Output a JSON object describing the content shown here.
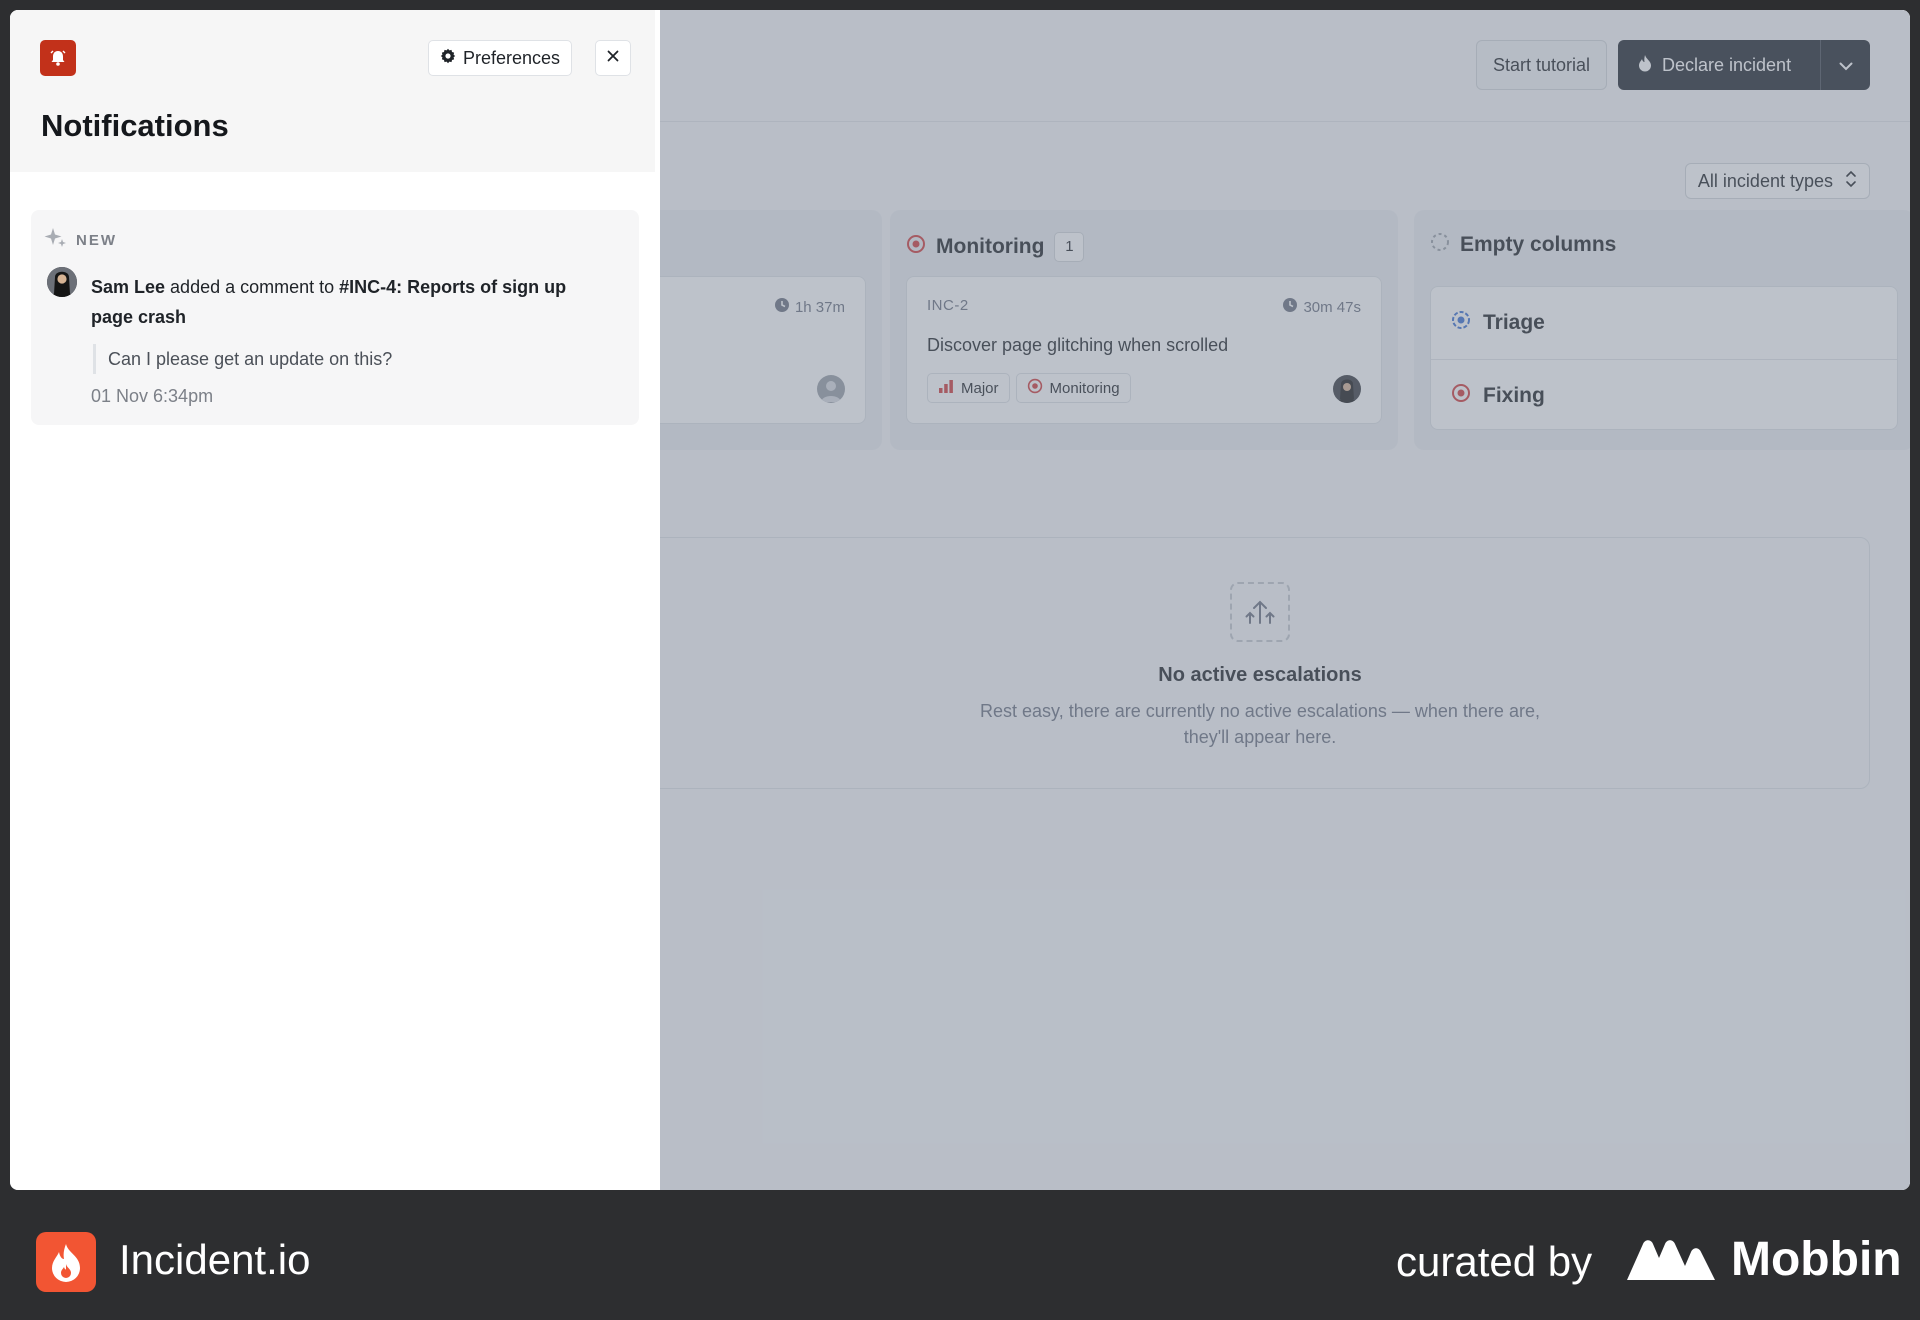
{
  "header": {
    "start_tutorial": "Start tutorial",
    "declare_incident": "Declare incident"
  },
  "filters": {
    "incident_types": "All incident types"
  },
  "board": {
    "col_a": {
      "duration": "1h 37m"
    },
    "monitoring": {
      "title": "Monitoring",
      "count": "1",
      "card": {
        "ref": "INC-2",
        "duration": "30m 47s",
        "title": "Discover page glitching when scrolled",
        "severity": "Major",
        "status": "Monitoring"
      }
    },
    "empty_columns": {
      "title": "Empty columns",
      "items": [
        "Triage",
        "Fixing"
      ]
    }
  },
  "escalations": {
    "title": "No active escalations",
    "body": "Rest easy, there are currently no active escalations — when there are, they'll appear here."
  },
  "notifications": {
    "title": "Notifications",
    "preferences": "Preferences",
    "close": "×",
    "items": [
      {
        "label": "NEW",
        "user": "Sam Lee",
        "action": " added a comment to ",
        "target": "#INC-4: Reports of sign up page crash",
        "quote": "Can I please get an update on this?",
        "time": "01 Nov 6:34pm"
      }
    ]
  },
  "footer": {
    "brand": "Incident.io",
    "curated_by": "curated by",
    "curator": "Mobbin"
  },
  "colors": {
    "brand": "#f25533",
    "bell_tile": "#c2311a",
    "declare_bg": "#22272e",
    "severity": "#d23b3b",
    "monitoring": "#d23b3b",
    "triage": "#3b6fd2"
  }
}
